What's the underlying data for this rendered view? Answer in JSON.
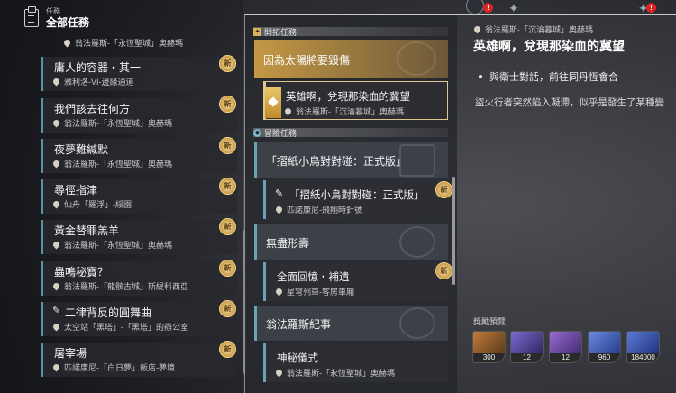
{
  "header": {
    "subtitle": "任務",
    "title": "全部任務"
  },
  "left_list": {
    "first_location": "翁法羅斯-「永恆聖城」奧赫瑪",
    "items": [
      {
        "title": "庸人的容器・其一",
        "location": "雅利洛-VI-邊緣通道",
        "new": true
      },
      {
        "title": "我們該去往何方",
        "location": "翁法羅斯-「永恆聖城」奧赫瑪",
        "new": true
      },
      {
        "title": "夜夢難緘默",
        "location": "翁法羅斯-「永恆聖城」奧赫瑪",
        "new": true
      },
      {
        "title": "尋徑指津",
        "location": "仙舟「羅浮」-綏園",
        "new": true
      },
      {
        "title": "黃金替罪羔羊",
        "location": "翁法羅斯-「永恆聖城」奧赫瑪",
        "new": true
      },
      {
        "title": "蟲鳴秘寶？",
        "location": "翁法羅斯-「龍骸古城」斯緹科西亞",
        "new": true
      },
      {
        "title": "二律背反的圓舞曲",
        "location": "太空站「黑塔」-「黑塔」的辦公室",
        "new": true
      },
      {
        "title": "屠宰場",
        "location": "匹諾康尼-「白日夢」飯店-夢境",
        "new": true
      }
    ],
    "new_label": "新"
  },
  "middle": {
    "section1": "開拓任務",
    "card1": "因為太陽將要毀傷",
    "sub1": {
      "title": "英雄啊，兌現那染血的冀望",
      "location": "翁法羅斯-「沉淪暮城」奧赫瑪"
    },
    "section2": "冒險任務",
    "card2": "「摺紙小鳥對對碰：正式版」",
    "sub2": {
      "title": "「摺紙小鳥對對碰：正式版」",
      "location": "匹諾康尼-飛翔時針號"
    },
    "card3": "無盡形壽",
    "sub3": {
      "title": "全面回憶・補遺",
      "location": "星穹列車-客房車廂"
    },
    "card4": "翁法羅斯紀事",
    "sub4": {
      "title": "神秘儀式",
      "location": "翁法羅斯-「永恆聖城」奧赫瑪"
    }
  },
  "detail": {
    "location": "翁法羅斯-「沉淪暮城」奧赫瑪",
    "title": "英雄啊，兌現那染血的冀望",
    "objective": "與衛士對話，前往同丹恆會合",
    "description": "盜火行者突然陷入凝滯，似乎是發生了某種變",
    "reward_label": "獎勵預覽",
    "rewards": [
      {
        "icon": "crystal-icon",
        "count": "300",
        "color": "#8a5a2a"
      },
      {
        "icon": "pass-icon",
        "count": "12",
        "color": "#4a3b8c"
      },
      {
        "icon": "ticket-icon",
        "count": "12",
        "color": "#6a4aa0"
      },
      {
        "icon": "exp-material-icon",
        "count": "960",
        "color": "#3a4fa8"
      },
      {
        "icon": "credit-icon",
        "count": "184000",
        "color": "#3a4fa8"
      }
    ]
  },
  "top_badges": [
    "!",
    "!"
  ]
}
